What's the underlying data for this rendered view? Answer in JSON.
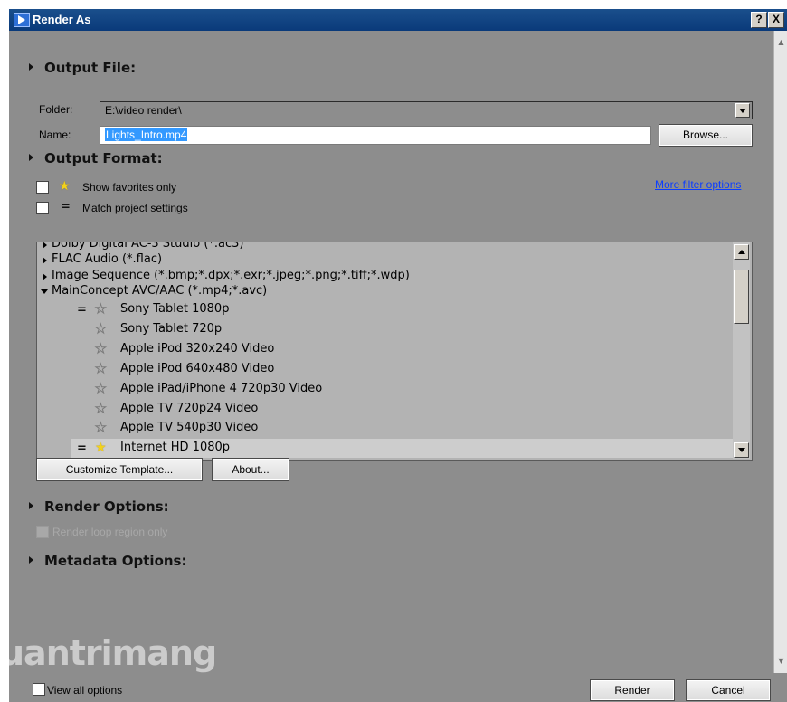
{
  "window": {
    "title": "Render As",
    "help_label": "?",
    "close_label": "X"
  },
  "output_file": {
    "heading": "Output File:",
    "folder_label": "Folder:",
    "folder_value": "E:\\video render\\",
    "name_label": "Name:",
    "name_value": "Lights_Intro.mp4",
    "browse_label": "Browse..."
  },
  "output_format": {
    "heading": "Output Format:",
    "show_favorites_label": "Show favorites only",
    "show_favorites_checked": false,
    "match_project_label": "Match project settings",
    "match_project_checked": false,
    "more_filter_label": "More filter options",
    "equals_symbol": "="
  },
  "format_list": {
    "rows": [
      {
        "text": "Dolby Digital AC-3 Studio (*.ac3)",
        "kind": "collapsed"
      },
      {
        "text": "FLAC Audio (*.flac)",
        "kind": "collapsed"
      },
      {
        "text": "Image Sequence (*.bmp;*.dpx;*.exr;*.jpeg;*.png;*.tiff;*.wdp)",
        "kind": "collapsed"
      },
      {
        "text": "MainConcept AVC/AAC (*.mp4;*.avc)",
        "kind": "expanded"
      },
      {
        "text": "Sony Tablet 1080p",
        "kind": "template",
        "star": "empty",
        "match": true
      },
      {
        "text": "Sony Tablet 720p",
        "kind": "template",
        "star": "empty",
        "match": false
      },
      {
        "text": "Apple iPod 320x240 Video",
        "kind": "template",
        "star": "empty",
        "match": false
      },
      {
        "text": "Apple iPod 640x480 Video",
        "kind": "template",
        "star": "empty",
        "match": false
      },
      {
        "text": "Apple iPad/iPhone 4 720p30 Video",
        "kind": "template",
        "star": "empty",
        "match": false
      },
      {
        "text": "Apple TV 720p24 Video",
        "kind": "template",
        "star": "empty",
        "match": false
      },
      {
        "text": "Apple TV 540p30 Video",
        "kind": "template",
        "star": "empty",
        "match": false
      },
      {
        "text": "Internet HD 1080p",
        "kind": "template",
        "star": "filled",
        "match": true,
        "selected": true
      }
    ]
  },
  "buttons": {
    "customize": "Customize Template...",
    "about": "About...",
    "render": "Render",
    "cancel": "Cancel"
  },
  "render_options": {
    "heading": "Render Options:",
    "loop_region_label": "Render loop region only",
    "loop_region_enabled": false
  },
  "metadata_options": {
    "heading": "Metadata Options:"
  },
  "footer": {
    "view_all_label": "View all options"
  },
  "watermark": {
    "text": "uantrimang"
  },
  "colors": {
    "titlebar": "#0a3a7a",
    "dialog_bg": "#8d8d8d",
    "list_bg": "#b3b3b3",
    "selection": "#3399ff",
    "link": "#0b3dff",
    "favorite_star": "#f3d21a"
  }
}
